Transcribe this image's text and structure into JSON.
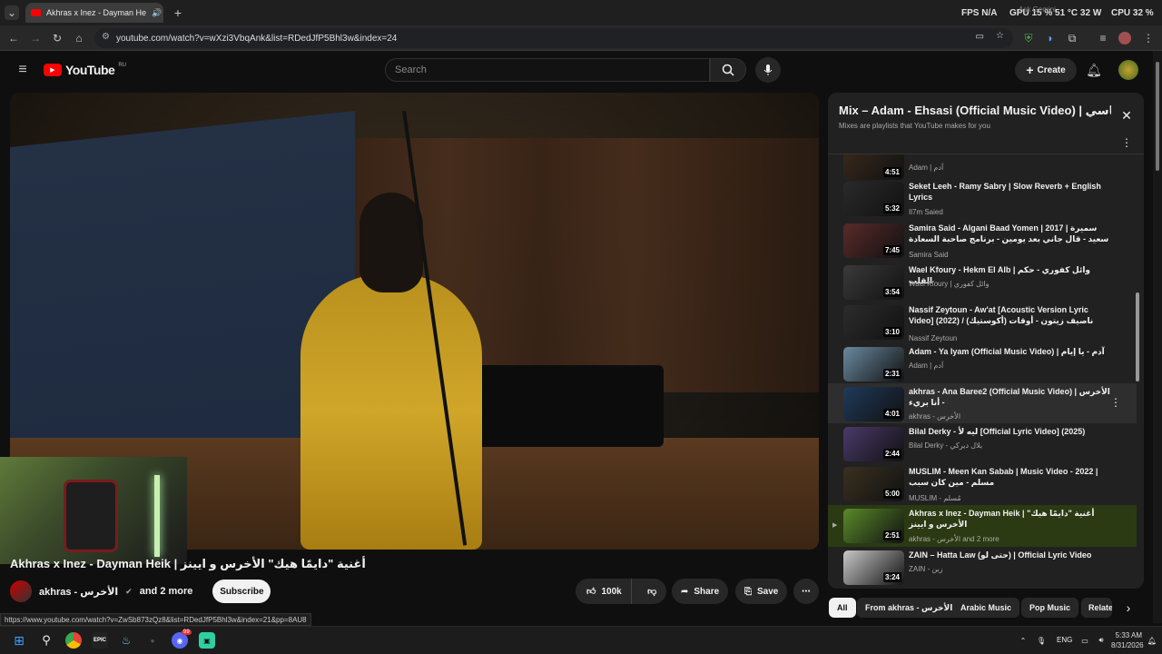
{
  "browser": {
    "tab_title": "Akhras x Inez - Dayman He",
    "url": "youtube.com/watch?v=wXzi3VbqAnk&list=RDedJfP5Bhl3w&index=24",
    "hud": {
      "fps_label": "FPS",
      "fps_value": "N/A",
      "gpu_label": "GPU",
      "gpu_value": "15 %  51 °C  32 W",
      "cpu_label": "CPU",
      "cpu_value": "32 %",
      "overlay_text": "Ask Gemini"
    }
  },
  "youtube": {
    "logo_text": "YouTube",
    "region": "RU",
    "search_placeholder": "Search",
    "create_label": "Create"
  },
  "video": {
    "title": "Akhras x Inez - Dayman Heik | أغنية \"دايمًا هيك\" الأخرس و ايينز",
    "channel": "akhras - الأخرس",
    "channel_more": "and 2 more",
    "subscribe_label": "Subscribe",
    "likes": "100k",
    "share_label": "Share",
    "save_label": "Save"
  },
  "status_url": "https://www.youtube.com/watch?v=ZwSb873zQz8&list=RDedJfP5Bhl3w&index=21&pp=8AU8",
  "playlist": {
    "title": "Mix – Adam - Ehsasi (Official Music Video) | آدم - احساسي",
    "subtitle": "Mixes are playlists that YouTube makes for you",
    "items": [
      {
        "title": "",
        "channel": "Adam | آدم",
        "duration": "4:51",
        "color": "#3a2a1c"
      },
      {
        "title": "Seket Leeh - Ramy Sabry | Slow Reverb + English Lyrics",
        "channel": "Il7m Saied",
        "duration": "5:32",
        "color": "#2a2a2a"
      },
      {
        "title": "Samira Said - Algani Baad Yomen | 2017 | سميرة سعيد - قال جاني بعد يومين - برنامج صاحبة السعادة",
        "channel": "Samira Said",
        "duration": "7:45",
        "color": "#5a2a2a"
      },
      {
        "title": "Wael Kfoury - Hekm El Alb | وائل كفوري - حكم القلب",
        "channel": "Wael Kfoury | وائل كفوري",
        "duration": "3:54",
        "color": "#3a3a3a"
      },
      {
        "title": "Nassif Zeytoun - Aw'at [Acoustic Version Lyric Video] (2022) / ناصيف زيتون - أوقات (أكوستيك)",
        "channel": "Nassif Zeytoun",
        "duration": "3:10",
        "color": "#2c2c2c"
      },
      {
        "title": "Adam - Ya Iyam (Official Music Video) | آدم - يا إيام",
        "channel": "Adam | آدم",
        "duration": "2:31",
        "color": "#6a8aa0"
      },
      {
        "title": "akhras - Ana Baree2 (Official Music Video) | الأخرس - أنا بريء",
        "channel": "akhras - الأخرس",
        "duration": "4:01",
        "color": "#1f3a5a"
      },
      {
        "title": "Bilal Derky - ليه لأ [Official Lyric Video] (2025)",
        "channel": "Bilal Derky - بلال ديركي",
        "duration": "2:44",
        "color": "#4a3a6a"
      },
      {
        "title": "MUSLIM - Meen Kan Sabab | Music Video - 2022 | مسلم - مين كان سبب",
        "channel": "MUSLIM - مُسلم",
        "duration": "5:00",
        "color": "#3a3020"
      },
      {
        "title": "Akhras x Inez - Dayman Heik | أغنية \"دايمًا هيك\" الأخرس و ايينز",
        "channel": "akhras - الأخرس and 2 more",
        "duration": "2:51",
        "color": "#5a8a2a"
      },
      {
        "title": "ZAIN – Hatta Law (حتى لو) | Official Lyric Video",
        "channel": "ZAIN - زين",
        "duration": "3:24",
        "color": "#c8c8c8"
      }
    ]
  },
  "chips": [
    "All",
    "From akhras - الأخرس",
    "Arabic Music",
    "Pop Music",
    "Relate"
  ],
  "taskbar": {
    "lang": "ENG",
    "time": "5:33 AM",
    "date": "8/31/2026",
    "discord_badge": "99"
  }
}
